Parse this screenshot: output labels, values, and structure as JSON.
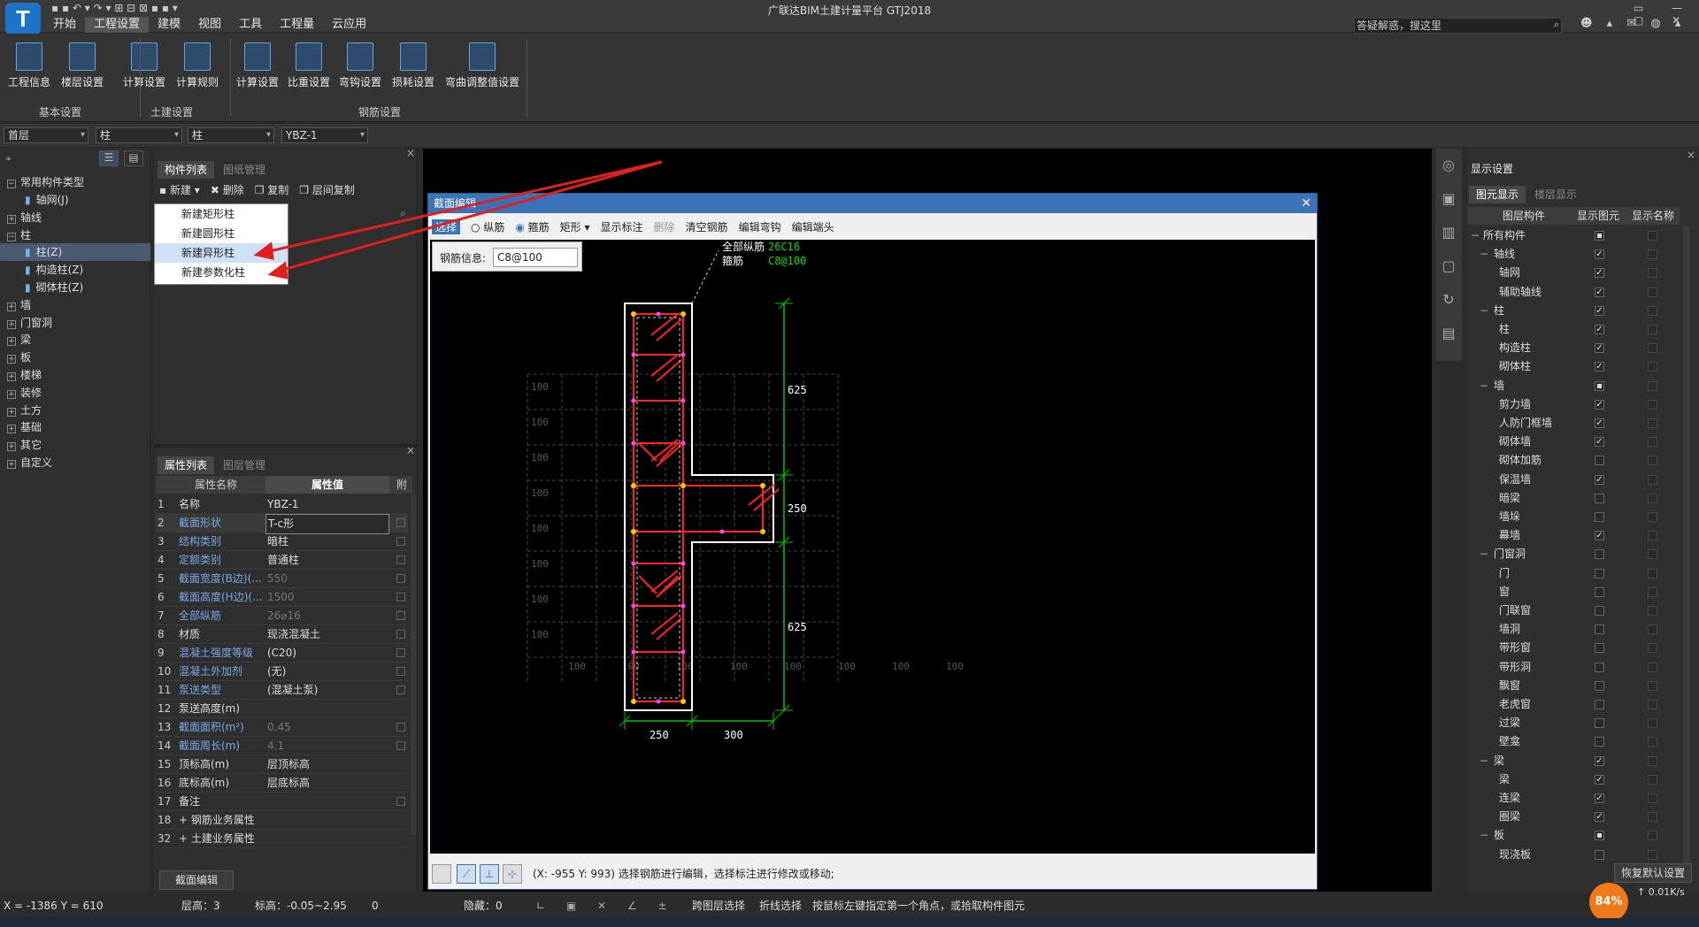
{
  "app": {
    "title": "广联达BIM土建计量平台 GTJ2018",
    "logo_letter": "T",
    "search_placeholder": "答疑解惑，搜这里"
  },
  "menu": [
    "开始",
    "工程设置",
    "建模",
    "视图",
    "工具",
    "工程量",
    "云应用"
  ],
  "menu_active": "工程设置",
  "ribbon": {
    "buttons": [
      "工程信息",
      "楼层设置",
      "计算设置",
      "计算规则",
      "计算设置",
      "比重设置",
      "弯钩设置",
      "损耗设置",
      "弯曲调整值设置"
    ],
    "groups": [
      "基本设置",
      "土建设置",
      "钢筋设置"
    ]
  },
  "selectors": [
    "首层",
    "柱",
    "柱",
    "YBZ-1"
  ],
  "left_tree": {
    "root": "常用构件类型",
    "items": [
      "轴网(J)",
      "轴线",
      "柱",
      "柱(Z)",
      "构造柱(Z)",
      "砌体柱(Z)",
      "墙",
      "门窗洞",
      "梁",
      "板",
      "楼梯",
      "装修",
      "土方",
      "基础",
      "其它",
      "自定义"
    ]
  },
  "component_panel": {
    "tabs": [
      "构件列表",
      "图纸管理"
    ],
    "toolbar": [
      "新建",
      "删除",
      "复制",
      "层间复制"
    ],
    "new_menu": [
      "新建矩形柱",
      "新建圆形柱",
      "新建异形柱",
      "新建参数化柱"
    ]
  },
  "props_panel": {
    "tabs": [
      "属性列表",
      "图层管理"
    ],
    "headers": [
      "属性名称",
      "属性值",
      "附"
    ],
    "rows": [
      {
        "n": "1",
        "k": "名称",
        "v": "YBZ-1"
      },
      {
        "n": "2",
        "k": "截面形状",
        "v": "T-c形"
      },
      {
        "n": "3",
        "k": "结构类别",
        "v": "暗柱"
      },
      {
        "n": "4",
        "k": "定额类别",
        "v": "普通柱"
      },
      {
        "n": "5",
        "k": "截面宽度(B边)(...",
        "v": "550"
      },
      {
        "n": "6",
        "k": "截面高度(H边)(...",
        "v": "1500"
      },
      {
        "n": "7",
        "k": "全部纵筋",
        "v": "26⌀16"
      },
      {
        "n": "8",
        "k": "材质",
        "v": "现浇混凝土"
      },
      {
        "n": "9",
        "k": "混凝土强度等级",
        "v": "(C20)"
      },
      {
        "n": "10",
        "k": "混凝土外加剂",
        "v": "(无)"
      },
      {
        "n": "11",
        "k": "泵送类型",
        "v": "(混凝土泵)"
      },
      {
        "n": "12",
        "k": "泵送高度(m)",
        "v": ""
      },
      {
        "n": "13",
        "k": "截面面积(m²)",
        "v": "0.45"
      },
      {
        "n": "14",
        "k": "截面周长(m)",
        "v": "4.1"
      },
      {
        "n": "15",
        "k": "顶标高(m)",
        "v": "层顶标高"
      },
      {
        "n": "16",
        "k": "底标高(m)",
        "v": "层底标高"
      },
      {
        "n": "17",
        "k": "备注",
        "v": ""
      },
      {
        "n": "18",
        "k": "+ 钢筋业务属性",
        "v": ""
      },
      {
        "n": "32",
        "k": "+ 土建业务属性",
        "v": ""
      }
    ],
    "bottom_button": "截面编辑"
  },
  "dialog": {
    "title": "截面编辑",
    "toolbar": [
      "选择",
      "纵筋",
      "箍筋",
      "矩形",
      "显示标注",
      "删除",
      "清空钢筋",
      "编辑弯钩",
      "编辑端头"
    ],
    "rebar_label": "钢筋信息:",
    "rebar_value": "C8@100",
    "anno_all_label": "全部纵筋",
    "anno_all_value": "26C16",
    "anno_stirrup_label": "箍筋",
    "anno_stirrup_value": "C8@100",
    "dims": [
      "625",
      "250",
      "625",
      "250",
      "300"
    ],
    "grid_label": "100",
    "status": "(X: -955 Y: 993) 选择钢筋进行编辑，选择标注进行修改或移动;"
  },
  "right_panel": {
    "title": "显示设置",
    "tabs": [
      "图元显示",
      "楼层显示"
    ],
    "headers": [
      "图层构件",
      "显示图元",
      "显示名称"
    ],
    "items": [
      {
        "label": "所有构件",
        "level": 0,
        "show": "partial",
        "name": false
      },
      {
        "label": "轴线",
        "level": 1,
        "show": true,
        "name": false
      },
      {
        "label": "轴网",
        "level": 2,
        "show": true,
        "name": false
      },
      {
        "label": "辅助轴线",
        "level": 2,
        "show": true,
        "name": false
      },
      {
        "label": "柱",
        "level": 1,
        "show": true,
        "name": false
      },
      {
        "label": "柱",
        "level": 2,
        "show": true,
        "name": false
      },
      {
        "label": "构造柱",
        "level": 2,
        "show": true,
        "name": false
      },
      {
        "label": "砌体柱",
        "level": 2,
        "show": true,
        "name": false
      },
      {
        "label": "墙",
        "level": 1,
        "show": "partial",
        "name": false
      },
      {
        "label": "剪力墙",
        "level": 2,
        "show": true,
        "name": false
      },
      {
        "label": "人防门框墙",
        "level": 2,
        "show": true,
        "name": false
      },
      {
        "label": "砌体墙",
        "level": 2,
        "show": true,
        "name": false
      },
      {
        "label": "砌体加筋",
        "level": 2,
        "show": false,
        "name": false
      },
      {
        "label": "保温墙",
        "level": 2,
        "show": true,
        "name": false
      },
      {
        "label": "暗梁",
        "level": 2,
        "show": false,
        "name": false
      },
      {
        "label": "墙垛",
        "level": 2,
        "show": false,
        "name": false
      },
      {
        "label": "幕墙",
        "level": 2,
        "show": true,
        "name": false
      },
      {
        "label": "门窗洞",
        "level": 1,
        "show": false,
        "name": false
      },
      {
        "label": "门",
        "level": 2,
        "show": false,
        "name": false
      },
      {
        "label": "窗",
        "level": 2,
        "show": false,
        "name": false
      },
      {
        "label": "门联窗",
        "level": 2,
        "show": false,
        "name": false
      },
      {
        "label": "墙洞",
        "level": 2,
        "show": false,
        "name": false
      },
      {
        "label": "带形窗",
        "level": 2,
        "show": false,
        "name": false
      },
      {
        "label": "带形洞",
        "level": 2,
        "show": false,
        "name": false
      },
      {
        "label": "飘窗",
        "level": 2,
        "show": false,
        "name": false
      },
      {
        "label": "老虎窗",
        "level": 2,
        "show": false,
        "name": false
      },
      {
        "label": "过梁",
        "level": 2,
        "show": false,
        "name": false
      },
      {
        "label": "壁龛",
        "level": 2,
        "show": false,
        "name": false
      },
      {
        "label": "梁",
        "level": 1,
        "show": true,
        "name": false
      },
      {
        "label": "梁",
        "level": 2,
        "show": true,
        "name": false
      },
      {
        "label": "连梁",
        "level": 2,
        "show": true,
        "name": false
      },
      {
        "label": "圈梁",
        "level": 2,
        "show": true,
        "name": false
      },
      {
        "label": "板",
        "level": 1,
        "show": "partial",
        "name": false
      },
      {
        "label": "现浇板",
        "level": 2,
        "show": false,
        "name": false
      }
    ],
    "restore_button": "恢复默认设置"
  },
  "statusbar": {
    "coords": "X = -1386 Y = 610",
    "floor_height": "层高：3",
    "elevation": "标高：-0.05~2.95",
    "count": "0",
    "hidden": "隐藏：0",
    "cross_layer": "跨图层选择",
    "polyline": "折线选择",
    "hint": "按鼠标左键指定第一个角点，或拾取构件图元"
  },
  "net_speed": {
    "percent": "84%",
    "rate": "0.01K/s"
  },
  "colors": {
    "accent": "#3b73b8",
    "rebar": "#ff2020",
    "dim": "#00c000",
    "arrow": "#e02020"
  }
}
